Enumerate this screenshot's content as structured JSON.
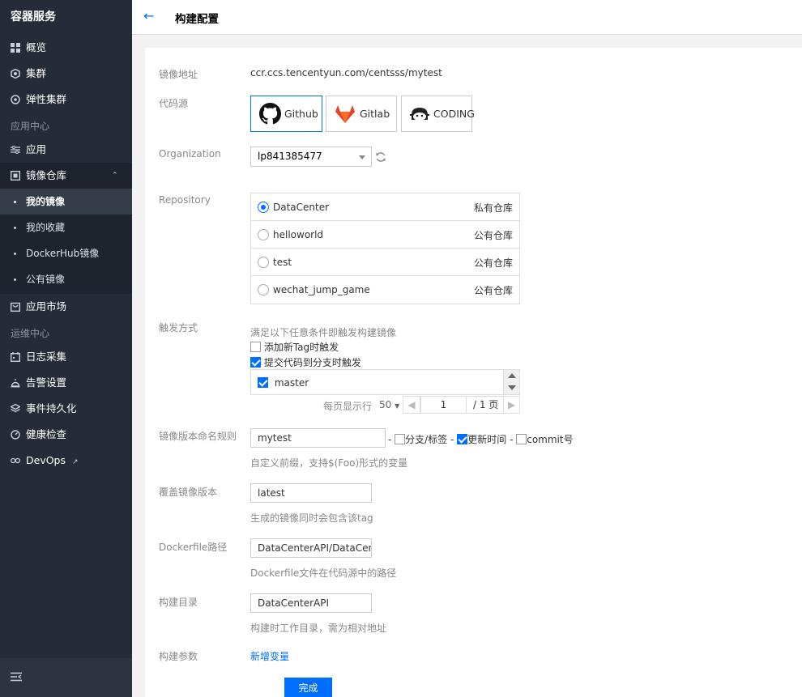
{
  "sidebar": {
    "title": "容器服务",
    "items": [
      {
        "label": "概览"
      },
      {
        "label": "集群"
      },
      {
        "label": "弹性集群"
      }
    ],
    "section_app": "应用中心",
    "app_items": [
      {
        "label": "应用"
      },
      {
        "label": "镜像仓库"
      }
    ],
    "sub_items": [
      {
        "label": "我的镜像"
      },
      {
        "label": "我的收藏"
      },
      {
        "label": "DockerHub镜像"
      },
      {
        "label": "公有镜像"
      }
    ],
    "market": "应用市场",
    "section_ops": "运维中心",
    "ops_items": [
      {
        "label": "日志采集"
      },
      {
        "label": "告警设置"
      },
      {
        "label": "事件持久化"
      },
      {
        "label": "健康检查"
      },
      {
        "label": "DevOps"
      }
    ]
  },
  "header": {
    "back": "←",
    "title": "构建配置"
  },
  "form": {
    "image_addr_label": "镜像地址",
    "image_addr": "ccr.ccs.tencentyun.com/centsss/mytest",
    "source_label": "代码源",
    "sources": [
      "Github",
      "Gitlab",
      "CODING"
    ],
    "org_label": "Organization",
    "org_value": "lp841385477",
    "repo_label": "Repository",
    "repos": [
      {
        "name": "DataCenter",
        "type": "私有仓库"
      },
      {
        "name": "helloworld",
        "type": "公有仓库"
      },
      {
        "name": "test",
        "type": "公有仓库"
      },
      {
        "name": "wechat_jump_game",
        "type": "公有仓库"
      }
    ],
    "trigger_label": "触发方式",
    "trigger_desc": "满足以下任意条件即触发构建镜像",
    "trigger_tag": "添加新Tag时触发",
    "trigger_branch": "提交代码到分支时触发",
    "branch": "master",
    "pager_per": "每页显示行",
    "pager_size": "50",
    "pager_page": "1",
    "pager_total": "/ 1 页",
    "rule_label": "镜像版本命名规则",
    "rule_value": "mytest",
    "rule_sep": "-",
    "rule_opt1": "分支/标签",
    "rule_opt2": "更新时间",
    "rule_opt3": "commit号",
    "rule_hint": "自定义前缀，支持$(Foo)形式的变量",
    "cover_label": "覆盖镜像版本",
    "cover_value": "latest",
    "cover_hint": "生成的镜像同时会包含该tag",
    "dockerfile_label": "Dockerfile路径",
    "dockerfile_value": "DataCenterAPI/DataCen",
    "dockerfile_hint": "Dockerfile文件在代码源中的路径",
    "dir_label": "构建目录",
    "dir_value": "DataCenterAPI",
    "dir_hint": "构建时工作目录，需为相对地址",
    "args_label": "构建参数",
    "add_var": "新增变量",
    "done": "完成"
  }
}
